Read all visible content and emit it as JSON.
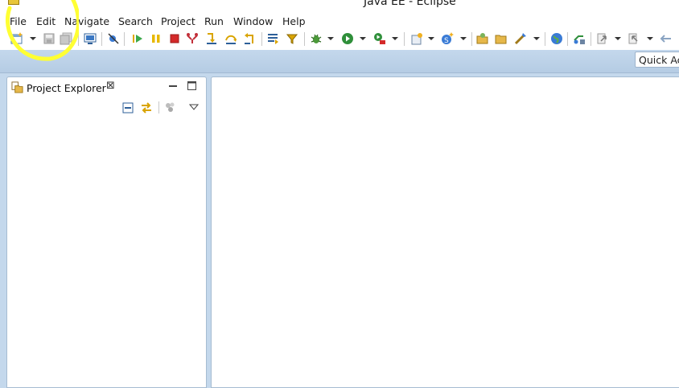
{
  "window": {
    "title": "Java EE - Eclipse"
  },
  "menubar": {
    "items": [
      {
        "name": "menu-file",
        "label": "File"
      },
      {
        "name": "menu-edit",
        "label": "Edit"
      },
      {
        "name": "menu-navigate",
        "label": "Navigate"
      },
      {
        "name": "menu-search",
        "label": "Search"
      },
      {
        "name": "menu-project",
        "label": "Project"
      },
      {
        "name": "menu-run",
        "label": "Run"
      },
      {
        "name": "menu-window",
        "label": "Window"
      },
      {
        "name": "menu-help",
        "label": "Help"
      }
    ]
  },
  "toolbar": {
    "icons": [
      "new-icon",
      "save-icon",
      "save-all-icon",
      "terminal-icon",
      "skip-breakpoints-icon",
      "resume-icon",
      "suspend-icon",
      "terminate-icon",
      "disconnect-icon",
      "step-into-icon",
      "step-over-icon",
      "step-return-icon",
      "drop-to-frame-icon",
      "use-step-filters-icon",
      "debug-icon",
      "run-icon",
      "run-external-tool-icon",
      "new-server-icon",
      "new-java-class-icon",
      "open-type-icon",
      "open-folder-icon",
      "open-task-icon",
      "web-browser-icon",
      "new-connection-icon",
      "next-annotation-icon",
      "previous-annotation-icon",
      "back-icon"
    ]
  },
  "quick_access": {
    "value": "Quick Ac"
  },
  "project_explorer": {
    "tab_label": "Project Explorer",
    "tab_close": "⊠",
    "actions": [
      "collapse-all-icon",
      "link-with-editor-icon",
      "filter-icon",
      "view-menu-icon"
    ]
  },
  "theme": {
    "accent": "#c4d8ec",
    "border": "#a6bcd2",
    "annotation": "#ffff33"
  }
}
